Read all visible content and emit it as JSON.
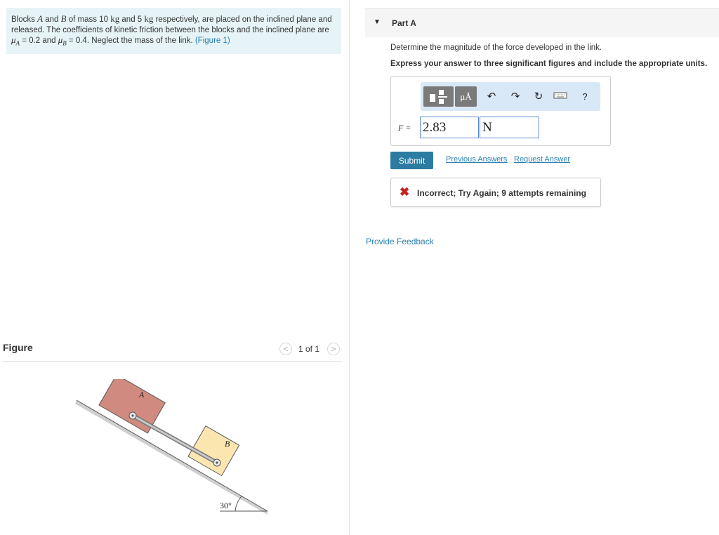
{
  "problem": {
    "t1": "Blocks ",
    "blockA": "A",
    "t2": " and ",
    "blockB": "B",
    "t3": " of mass 10 ",
    "unit1": "kg",
    "t4": " and 5 ",
    "unit2": "kg",
    "t5": " respectively, are placed on the inclined plane and released. The coefficients of kinetic friction between the blocks and the inclined plane are ",
    "muA_sym": "μ",
    "muA_sub": "A",
    "muA_val": " = 0.2 and ",
    "muB_sym": "μ",
    "muB_sub": "B",
    "muB_val": " = 0.4. Neglect the mass of the link. ",
    "figure_link": "(Figure 1)"
  },
  "figure": {
    "label": "Figure",
    "pager_prev": "<",
    "pager_text": "1 of 1",
    "pager_next": ">",
    "label_a": "A",
    "label_b": "B",
    "angle": "30°"
  },
  "part": {
    "title": "Part A",
    "question": "Determine the magnitude of the force developed in the link.",
    "instruction": "Express your answer to three significant figures and include the appropriate units."
  },
  "answer": {
    "variable": "F =",
    "value": "2.83",
    "unit": "N",
    "units_button": "μÅ",
    "help": "?"
  },
  "actions": {
    "submit": "Submit",
    "previous_answers": "Previous Answers",
    "request_answer": "Request Answer"
  },
  "feedback": {
    "message": "Incorrect; Try Again; 9 attempts remaining",
    "provide_feedback": "Provide Feedback"
  },
  "colors": {
    "problem_bg": "#e6f4f7",
    "link": "#2a7fb0",
    "submit_bg": "#2b7ba3",
    "toolbar_bg": "#d9e8f7",
    "error": "#c8201d",
    "block_a": "#d18a7f",
    "block_b": "#fbe6b0"
  }
}
